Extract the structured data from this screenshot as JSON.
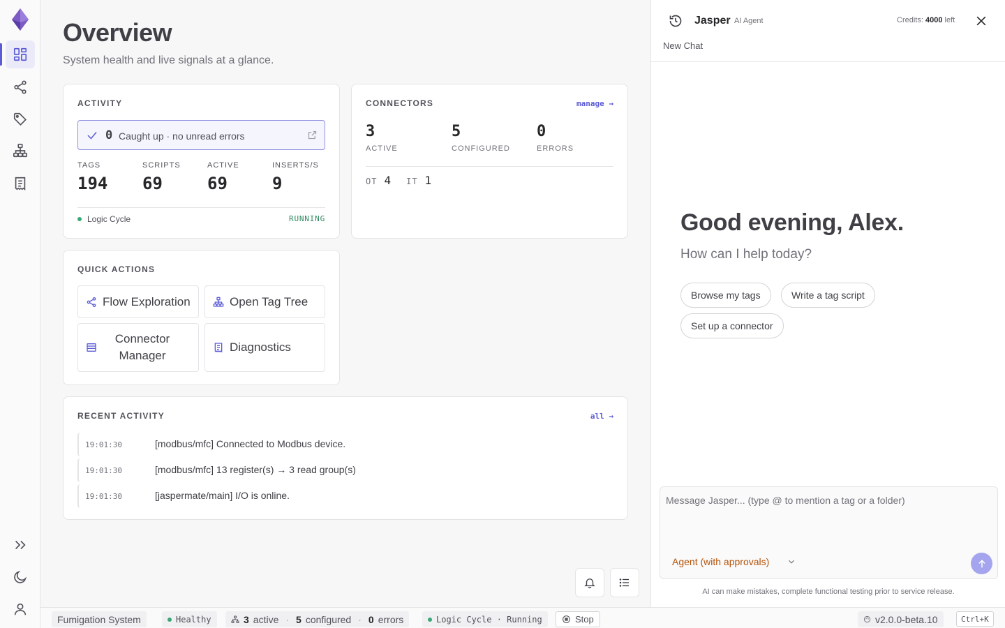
{
  "rail": {
    "icons": [
      "logo-icon",
      "overview-icon",
      "flow-icon",
      "tag-icon",
      "tag-tree-icon",
      "diagnostics-icon",
      "expand-icon",
      "theme-icon",
      "user-icon"
    ]
  },
  "page": {
    "title": "Overview",
    "subtitle": "System health and live signals at a glance."
  },
  "activity": {
    "title": "ACTIVITY",
    "unread_count": "0",
    "unread_text": "Caught up · no unread errors",
    "stats": [
      {
        "label": "TAGS",
        "value": "194"
      },
      {
        "label": "SCRIPTS",
        "value": "69"
      },
      {
        "label": "ACTIVE",
        "value": "69"
      },
      {
        "label": "INSERTS/S",
        "value": "9"
      }
    ],
    "logic_label": "Logic Cycle",
    "logic_state": "RUNNING"
  },
  "connectors": {
    "title": "CONNECTORS",
    "manage_label": "manage →",
    "stats": [
      {
        "value": "3",
        "label": "ACTIVE"
      },
      {
        "value": "5",
        "label": "CONFIGURED"
      },
      {
        "value": "0",
        "label": "ERRORS"
      }
    ],
    "ot_label": "OT",
    "ot_value": "4",
    "it_label": "IT",
    "it_value": "1"
  },
  "quick_actions": {
    "title": "QUICK ACTIONS",
    "items": [
      {
        "label": "Flow Exploration",
        "icon": "flow-icon"
      },
      {
        "label": "Open Tag Tree",
        "icon": "tag-tree-icon"
      },
      {
        "label": "Connector Manager",
        "icon": "connector-icon"
      },
      {
        "label": "Diagnostics",
        "icon": "diagnostics-icon"
      }
    ]
  },
  "recent": {
    "title": "RECENT ACTIVITY",
    "all_label": "all →",
    "rows": [
      {
        "time": "19:01:30",
        "msg": "[modbus/mfc] Connected to Modbus device."
      },
      {
        "time": "19:01:30",
        "msg": "[modbus/mfc] 13 register(s) → 3 read group(s)"
      },
      {
        "time": "19:01:30",
        "msg": "[jaspermate/main] I/O is online."
      }
    ]
  },
  "statusbar": {
    "system": "Fumigation System",
    "health": "Healthy",
    "active_count": "3",
    "active_label": "active",
    "configured_count": "5",
    "configured_label": "configured",
    "errors_count": "0",
    "errors_label": "errors",
    "logic": "Logic Cycle · Running",
    "stop_label": "Stop",
    "version": "v2.0.0-beta.10",
    "shortcut": "Ctrl+K"
  },
  "assistant": {
    "name": "Jasper",
    "role": "AI Agent",
    "credits_label": "Credits:",
    "credits_value": "4000",
    "credits_suffix": "left",
    "new_chat": "New Chat",
    "greeting": "Good evening, Alex.",
    "subgreeting": "How can I help today?",
    "suggestions": [
      "Browse my tags",
      "Write a tag script",
      "Set up a connector"
    ],
    "placeholder": "Message Jasper... (type @ to mention a tag or a folder)",
    "mode": "Agent (with approvals)",
    "disclaimer": "AI can make mistakes, complete functional testing prior to service release."
  },
  "colors": {
    "accent": "#5b5bd6",
    "healthy": "#3aa776",
    "mode": "#b45309"
  }
}
